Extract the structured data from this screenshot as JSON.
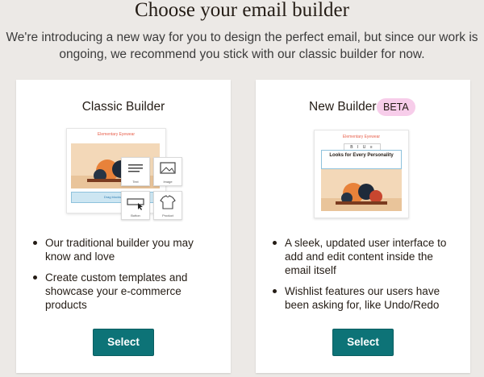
{
  "header": {
    "title": "Choose your email builder",
    "subtitle": "We're introducing a new way for you to design the perfect email, but since our work is ongoing, we recommend you stick with our classic builder for now."
  },
  "classic": {
    "title": "Classic Builder",
    "preview": {
      "brand": "Elementary Eyewear",
      "bar_label": "Drag blocks here",
      "tiles": [
        "Text",
        "Image",
        "Button",
        "Product"
      ]
    },
    "bullets": [
      "Our traditional builder you may know and love",
      "Create custom templates and showcase your e-commerce products"
    ],
    "button_label": "Select"
  },
  "new": {
    "title": "New Builder",
    "badge": "BETA",
    "preview": {
      "brand": "Elementary Eyewear",
      "toolbar": "B I U ≡",
      "headline": "Looks for Every Personality"
    },
    "bullets": [
      "A sleek, updated user interface to add and edit content inside the email itself",
      "Wishlist features our users have been asking for, like Undo/Redo"
    ],
    "button_label": "Select"
  },
  "colors": {
    "accent": "#0d7377",
    "badge_bg": "#f7cdea",
    "background": "#ece9e6"
  }
}
